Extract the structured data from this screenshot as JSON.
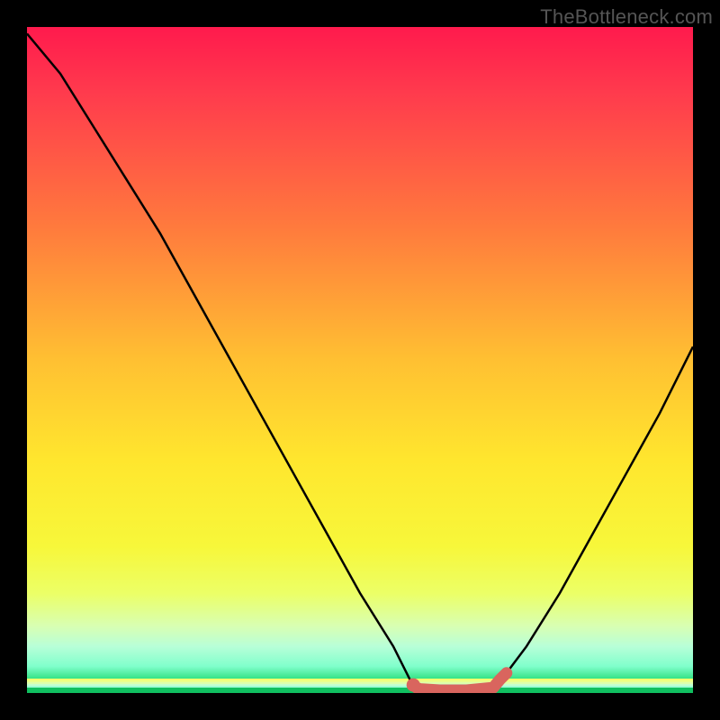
{
  "watermark": "TheBottleneck.com",
  "colors": {
    "curve": "#000000",
    "marker": "#d9655e",
    "gradient_top": "#ff1a4d",
    "gradient_bottom": "#00c060"
  },
  "chart_data": {
    "type": "line",
    "title": "",
    "xlabel": "",
    "ylabel": "",
    "xlim": [
      0,
      100
    ],
    "ylim": [
      0,
      100
    ],
    "x": [
      0,
      5,
      10,
      15,
      20,
      25,
      30,
      35,
      40,
      45,
      50,
      55,
      58,
      62,
      66,
      70,
      72,
      75,
      80,
      85,
      90,
      95,
      100
    ],
    "values": [
      99,
      93,
      85,
      77,
      69,
      60,
      51,
      42,
      33,
      24,
      15,
      7,
      1,
      0,
      0,
      1,
      3,
      7,
      15,
      24,
      33,
      42,
      52
    ],
    "marker": {
      "segment_x": [
        58,
        58.5,
        59,
        62,
        66,
        70,
        71,
        72
      ],
      "segment_y": [
        1.2,
        0.8,
        0.6,
        0.4,
        0.4,
        0.8,
        2,
        3
      ],
      "dot": {
        "x": 58,
        "y": 1.2
      }
    },
    "annotations": []
  }
}
